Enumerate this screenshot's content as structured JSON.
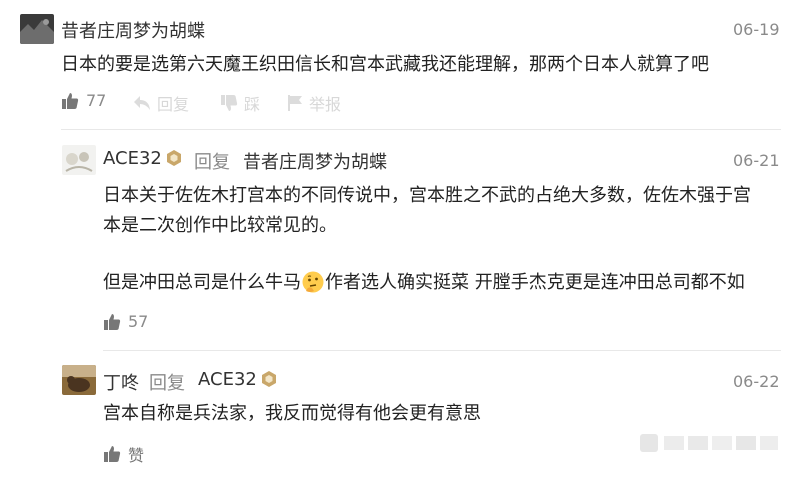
{
  "comments": [
    {
      "author": "昔者庄周梦为胡蝶",
      "date": "06-19",
      "text": "日本的要是选第六天魔王织田信长和宫本武藏我还能理解，那两个日本人就算了吧",
      "likes": "77",
      "reply_label": "回复",
      "dislike_label": "踩",
      "report_label": "举报"
    },
    {
      "author": "ACE32",
      "reply_word": "回复",
      "reply_to": "昔者庄周梦为胡蝶",
      "date": "06-21",
      "text_line1": "日本关于佐佐木打宫本的不同传说中，宫本胜之不武的占绝大多数，佐佐木强于宫",
      "text_line2": "本是二次创作中比较常见的。",
      "text_line3_before": "但是冲田总司是什么牛马",
      "text_line3_after": "作者选人确实挺菜 开膛手杰克更是连冲田总司都不如",
      "likes": "57"
    },
    {
      "author": "丁咚",
      "reply_word": "回复",
      "reply_to": "ACE32",
      "date": "06-22",
      "text": "宫本自称是兵法家，我反而觉得有他会更有意思",
      "like_label": "赞"
    }
  ],
  "icons": {
    "like": "thumbs-up-icon",
    "reply": "reply-arrow-icon",
    "dislike": "thumbs-down-icon",
    "report": "flag-icon",
    "badge": "level-badge-icon",
    "emoji": "thinking-face-emoji"
  },
  "colors": {
    "text": "#222222",
    "meta": "#8a8a8a",
    "like_icon": "#777777",
    "faded": "#d8d8d8",
    "badge": "#c9a76a"
  }
}
